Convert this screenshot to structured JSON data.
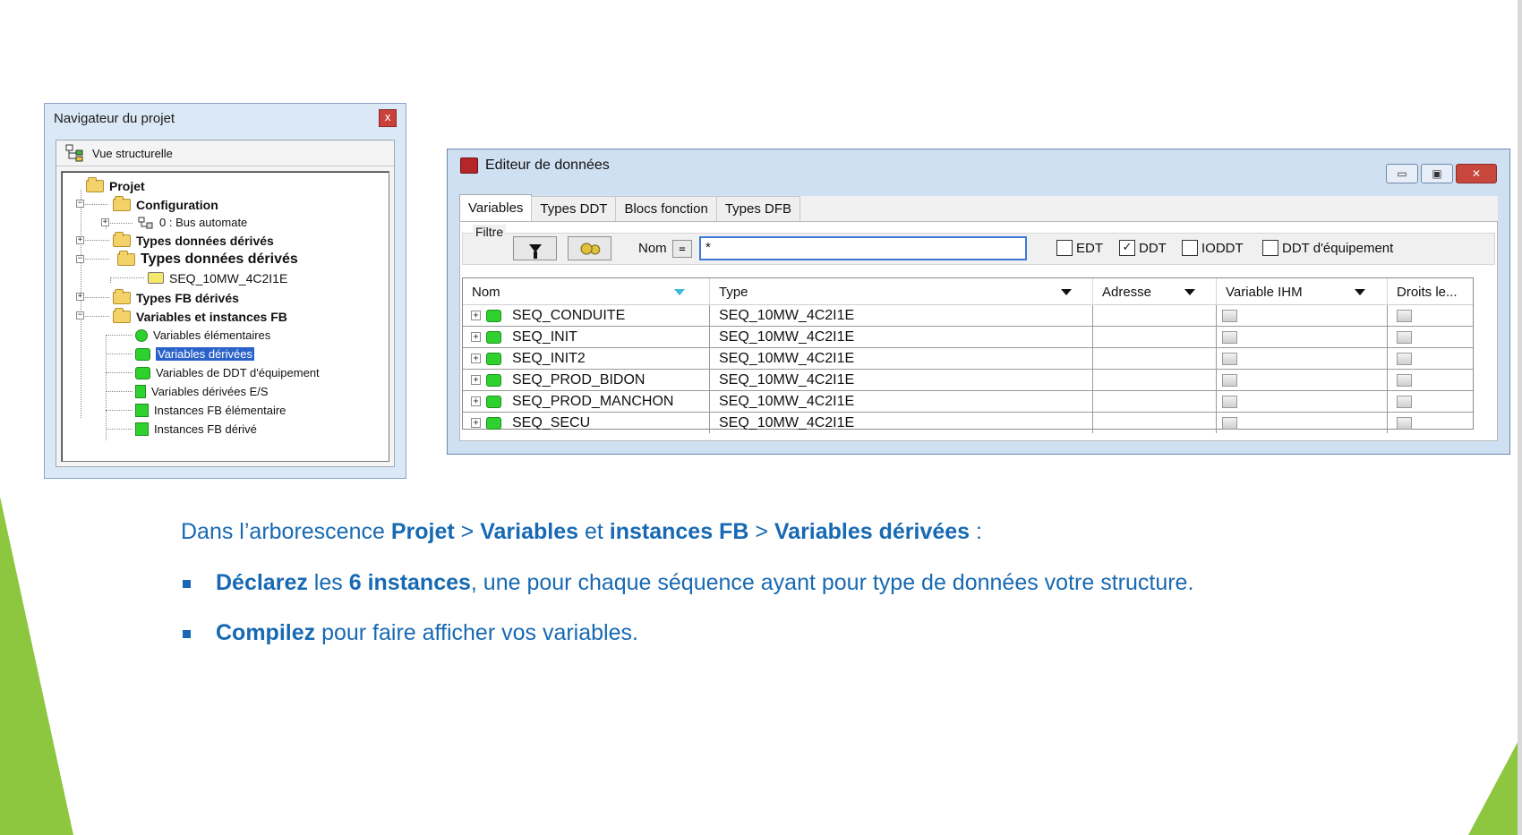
{
  "navigator": {
    "title": "Navigateur du projet",
    "close_label": "x",
    "view_label": "Vue structurelle",
    "tree": [
      {
        "label": "Projet",
        "level": 0,
        "bold": true,
        "expander": "",
        "icon": "folder-open-icon"
      },
      {
        "label": "Configuration",
        "level": 1,
        "bold": true,
        "expander": "−",
        "icon": "folder-open-icon"
      },
      {
        "label": "0 : Bus automate",
        "level": 2,
        "bold": false,
        "expander": "+",
        "icon": "bus-icon"
      },
      {
        "label": "Types données dérivés",
        "level": 1,
        "bold": true,
        "expander": "+",
        "icon": "folder-icon"
      },
      {
        "label": "Types données dérivés",
        "level": 1,
        "bold": true,
        "expander": "−",
        "icon": "folder-open-icon"
      },
      {
        "label": "SEQ_10MW_4C2I1E",
        "level": 2,
        "bold": false,
        "expander": "",
        "icon": "ddt-icon"
      },
      {
        "label": "Types FB dérivés",
        "level": 1,
        "bold": true,
        "expander": "+",
        "icon": "folder-icon"
      },
      {
        "label": "Variables et instances FB",
        "level": 1,
        "bold": true,
        "expander": "−",
        "icon": "folder-open-icon"
      },
      {
        "label": "Variables élémentaires",
        "level": 2,
        "bold": false,
        "expander": "",
        "icon": "elementary-variable-icon"
      },
      {
        "label": "Variables dérivées",
        "level": 2,
        "bold": false,
        "expander": "",
        "icon": "derived-variable-icon",
        "selected": true
      },
      {
        "label": "Variables de DDT d'équipement",
        "level": 2,
        "bold": false,
        "expander": "",
        "icon": "device-ddt-variable-icon"
      },
      {
        "label": "Variables dérivées E/S",
        "level": 2,
        "bold": false,
        "expander": "",
        "icon": "io-variable-icon"
      },
      {
        "label": "Instances FB élémentaire",
        "level": 2,
        "bold": false,
        "expander": "",
        "icon": "fb-instance-icon"
      },
      {
        "label": "Instances FB dérivé",
        "level": 2,
        "bold": false,
        "expander": "",
        "icon": "fb-instance-icon"
      }
    ]
  },
  "editor": {
    "title": "Editeur de données",
    "window_buttons": {
      "minimize": "▭",
      "maximize": "▣",
      "close": "✕"
    },
    "tabs": [
      {
        "label": "Variables",
        "active": true
      },
      {
        "label": "Types DDT",
        "active": false
      },
      {
        "label": "Blocs fonction",
        "active": false
      },
      {
        "label": "Types DFB",
        "active": false
      }
    ],
    "filter": {
      "legend": "Filtre",
      "name_label": "Nom",
      "equals_label": "=",
      "value": "*",
      "checkboxes": [
        {
          "label": "EDT",
          "checked": false,
          "mark": ""
        },
        {
          "label": "DDT",
          "checked": true,
          "mark": "✓"
        },
        {
          "label": "IODDT",
          "checked": false,
          "mark": ""
        },
        {
          "label": "DDT d'équipement",
          "checked": false,
          "mark": ""
        }
      ]
    },
    "columns": [
      "Nom",
      "Type",
      "Adresse",
      "Variable IHM",
      "Droits le..."
    ],
    "rows": [
      {
        "name": "SEQ_CONDUITE",
        "type": "SEQ_10MW_4C2I1E",
        "address": ""
      },
      {
        "name": "SEQ_INIT",
        "type": "SEQ_10MW_4C2I1E",
        "address": ""
      },
      {
        "name": "SEQ_INIT2",
        "type": "SEQ_10MW_4C2I1E",
        "address": ""
      },
      {
        "name": "SEQ_PROD_BIDON",
        "type": "SEQ_10MW_4C2I1E",
        "address": ""
      },
      {
        "name": "SEQ_PROD_MANCHON",
        "type": "SEQ_10MW_4C2I1E",
        "address": ""
      },
      {
        "name": "SEQ_SECU",
        "type": "SEQ_10MW_4C2I1E",
        "address": ""
      }
    ]
  },
  "slide": {
    "line1": {
      "t1": "Dans l’arborescence ",
      "b1": "Projet",
      "t2": " > ",
      "b2": "Variables",
      "t3": " et ",
      "b3": "instances FB",
      "t4": " > ",
      "b4": "Variables dérivées",
      "t5": " :"
    },
    "bullet1": {
      "b1": "Déclarez",
      "t1": " les ",
      "b2": "6 instances",
      "t2": ", une pour chaque séquence ayant pour type de données votre structure."
    },
    "bullet2": {
      "b1": "Compilez",
      "t1": " pour faire afficher vos variables."
    },
    "accent_color": "#1769b3",
    "decoration_color": "#8dc63f"
  }
}
